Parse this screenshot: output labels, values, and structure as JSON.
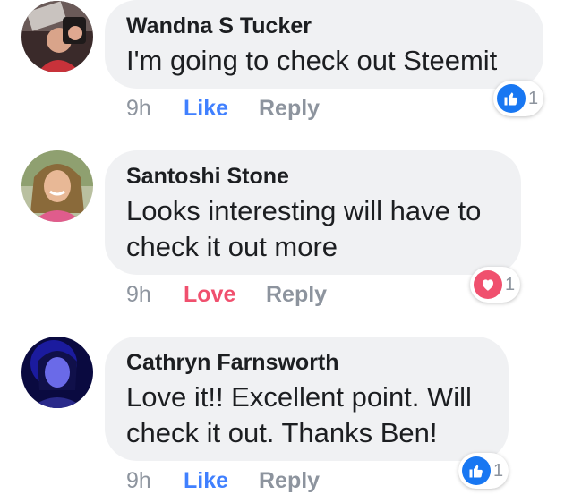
{
  "comments": [
    {
      "author": "Wandna S Tucker",
      "text": "I'm going to check out Steemit",
      "time": "9h",
      "action": "Like",
      "reply": "Reply",
      "reaction": {
        "icon": "thumbs-up-icon",
        "count": "1",
        "color": "#1877f2"
      }
    },
    {
      "author": "Santoshi Stone",
      "text": "Looks interesting will have to check it out more",
      "time": "9h",
      "action": "Love",
      "reply": "Reply",
      "reaction": {
        "icon": "heart-icon",
        "count": "1",
        "color": "#f0506e"
      }
    },
    {
      "author": "Cathryn Farnsworth",
      "text": "Love it!! Excellent point. Will check it out. Thanks Ben!",
      "time": "9h",
      "action": "Like",
      "reply": "Reply",
      "reaction": {
        "icon": "thumbs-up-icon",
        "count": "1",
        "color": "#1877f2"
      }
    }
  ],
  "colors": {
    "bubble": "#f0f1f3",
    "like_action": "#4080ff",
    "love_action": "#f0506e",
    "muted": "#8d949e"
  }
}
